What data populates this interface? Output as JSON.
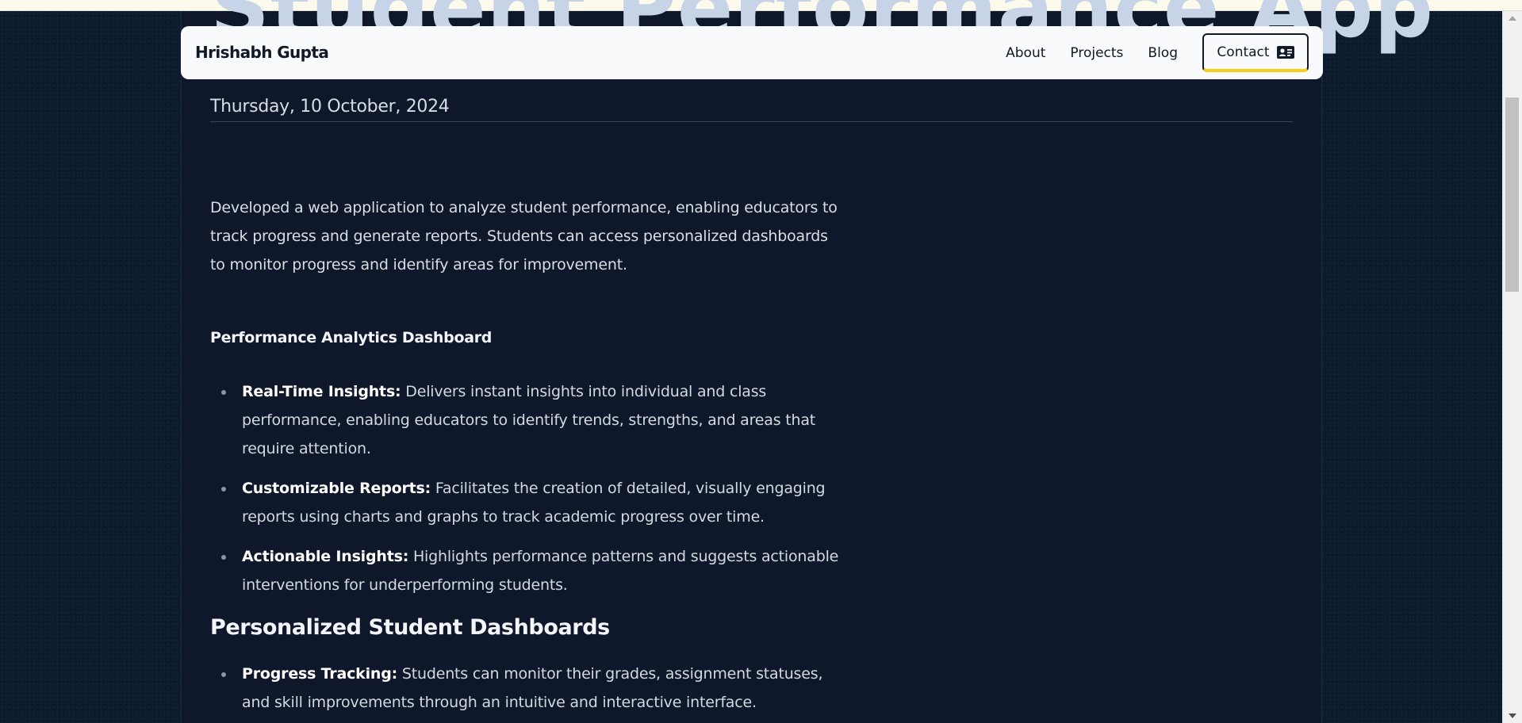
{
  "page": {
    "hero_title": "Student Performance App",
    "date": "Thursday, 10 October, 2024"
  },
  "navbar": {
    "brand": "Hrishabh Gupta",
    "links": [
      "About",
      "Projects",
      "Blog"
    ],
    "contact_label": "Contact",
    "contact_icon": "contact-card-icon",
    "accent_color": "#facc15"
  },
  "content": {
    "intro": "Developed a web application to analyze student performance, enabling educators to track progress and generate reports. Students can access personalized dashboards to monitor progress and identify areas for improvement.",
    "section1": {
      "heading": "Performance Analytics Dashboard",
      "items": [
        {
          "title": "Real-Time Insights:",
          "text": "Delivers instant insights into individual and class performance, enabling educators to identify trends, strengths, and areas that require attention."
        },
        {
          "title": "Customizable Reports:",
          "text": "Facilitates the creation of detailed, visually engaging reports using charts and graphs to track academic progress over time."
        },
        {
          "title": "Actionable Insights:",
          "text": "Highlights performance patterns and suggests actionable interventions for underperforming students."
        }
      ]
    },
    "section2": {
      "heading": "Personalized Student Dashboards",
      "items": [
        {
          "title": "Progress Tracking:",
          "text": "Students can monitor their grades, assignment statuses, and skill improvements through an intuitive and interactive interface."
        }
      ]
    }
  },
  "colors": {
    "page_background": "#0d1b2e",
    "article_background": "#0f172a",
    "navbar_background": "#f8fafc"
  }
}
